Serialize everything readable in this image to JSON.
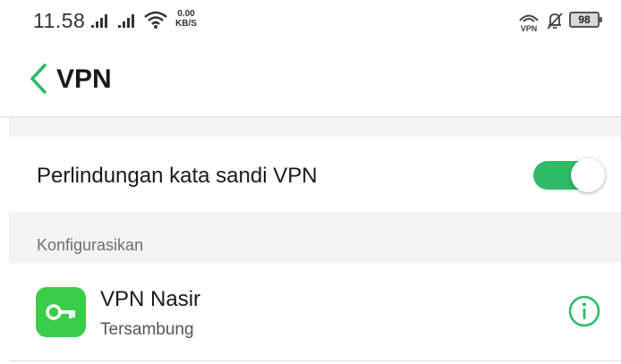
{
  "status_bar": {
    "time": "11.58",
    "net_speed_value": "0.00",
    "net_speed_unit": "KB/S",
    "battery_level": "98",
    "vpn_badge": "VPN",
    "icons": [
      "signal-icon",
      "signal-icon",
      "wifi-icon",
      "vpn-key-icon",
      "bell-muted-icon",
      "battery-icon"
    ]
  },
  "header": {
    "title": "VPN",
    "back_icon": "chevron-left-icon"
  },
  "protection": {
    "label": "Perlindungan kata sandi VPN",
    "enabled": true
  },
  "section": {
    "label": "Konfigurasikan"
  },
  "vpn_profiles": [
    {
      "name": "VPN Nasir",
      "status": "Tersambung",
      "icon": "key-icon",
      "action_icon": "info-icon"
    }
  ],
  "colors": {
    "accent": "#2dbb66",
    "app_icon_bg": "#3dcc4a",
    "section_bg": "#f3f3f3",
    "text_primary": "#1a1a1a",
    "text_secondary": "#6f6f6f"
  }
}
